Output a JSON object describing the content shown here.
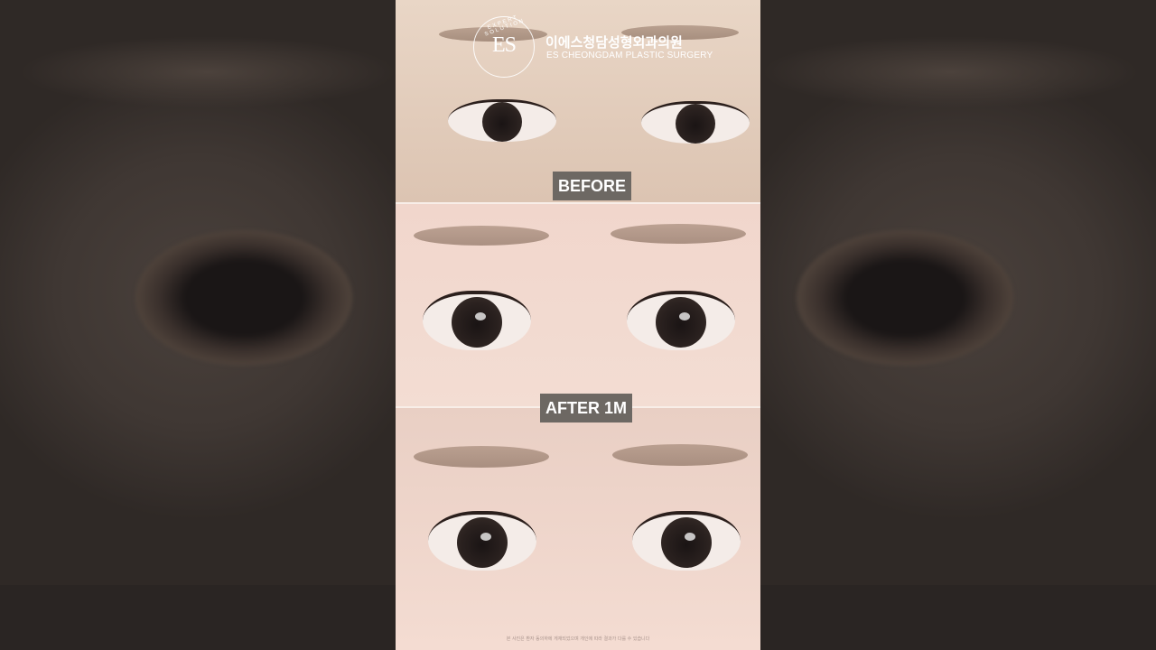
{
  "clinic": {
    "name_kr": "이에스청담성형외과의원",
    "name_en": "ES CHEONGDAM PLASTIC SURGERY",
    "logo_mark": "ES",
    "logo_ring": "EXPERT SOLUTION"
  },
  "panels": {
    "before_label": "BEFORE",
    "after_label": "AFTER 1M"
  },
  "footer": {
    "disclaimer": "본 사진은 환자 동의하에 게재되었으며 개인에 따라 결과가 다를 수 있습니다"
  }
}
